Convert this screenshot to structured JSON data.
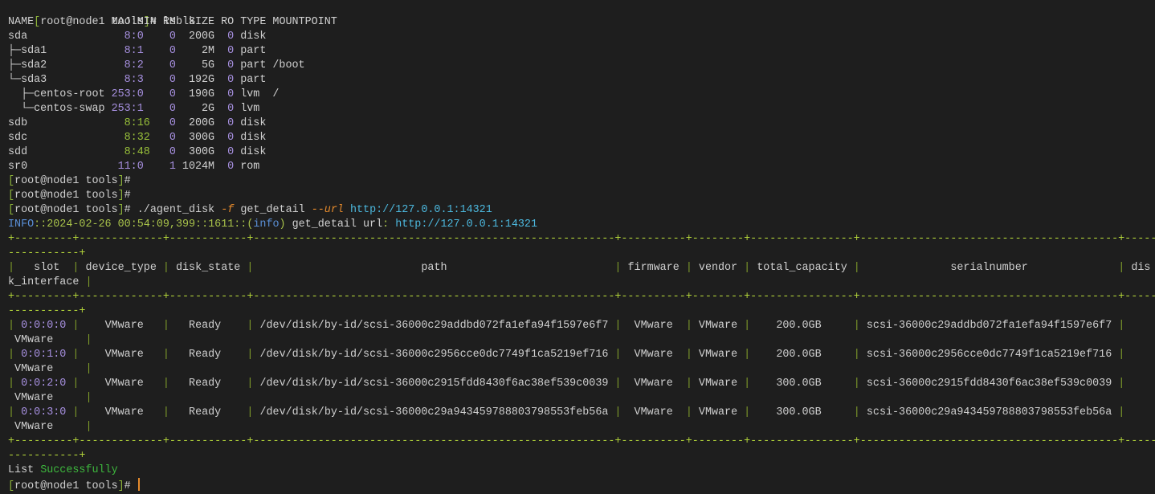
{
  "prompt": {
    "open": "[",
    "user_host": "root@node1 tools",
    "close": "]",
    "hash": "# "
  },
  "commands": {
    "lsblk": "lsblk",
    "agent": {
      "program": "./agent_disk ",
      "flag_f": "-f",
      "action": " get_detail ",
      "flag_url": "--url",
      "url": " http://127.0.0.1:14321"
    }
  },
  "lsblk": {
    "headers": {
      "name": "NAME",
      "majmin": "MAJ:MIN",
      "rm": "RM",
      "size": "SIZE",
      "ro": "RO",
      "type": "TYPE",
      "mountpoint": "MOUNTPOINT"
    },
    "rows": [
      {
        "name": "sda",
        "maj": "8",
        "min": "0",
        "rm": "0",
        "size": "200G",
        "ro": "0",
        "type": "disk",
        "mountpoint": "",
        "color": "purple"
      },
      {
        "name": "├─sda1",
        "maj": "8",
        "min": "1",
        "rm": "0",
        "size": "2M",
        "ro": "0",
        "type": "part",
        "mountpoint": "",
        "color": "purple"
      },
      {
        "name": "├─sda2",
        "maj": "8",
        "min": "2",
        "rm": "0",
        "size": "5G",
        "ro": "0",
        "type": "part",
        "mountpoint": "/boot",
        "color": "purple"
      },
      {
        "name": "└─sda3",
        "maj": "8",
        "min": "3",
        "rm": "0",
        "size": "192G",
        "ro": "0",
        "type": "part",
        "mountpoint": "",
        "color": "purple"
      },
      {
        "name": "  ├─centos-root",
        "maj": "253",
        "min": "0",
        "rm": "0",
        "size": "190G",
        "ro": "0",
        "type": "lvm",
        "mountpoint": "/",
        "color": "purple"
      },
      {
        "name": "  └─centos-swap",
        "maj": "253",
        "min": "1",
        "rm": "0",
        "size": "2G",
        "ro": "0",
        "type": "lvm",
        "mountpoint": "",
        "color": "purple"
      },
      {
        "name": "sdb",
        "maj": "8",
        "min": "16",
        "rm": "0",
        "size": "200G",
        "ro": "0",
        "type": "disk",
        "mountpoint": "",
        "color": "green"
      },
      {
        "name": "sdc",
        "maj": "8",
        "min": "32",
        "rm": "0",
        "size": "300G",
        "ro": "0",
        "type": "disk",
        "mountpoint": "",
        "color": "green"
      },
      {
        "name": "sdd",
        "maj": "8",
        "min": "48",
        "rm": "0",
        "size": "300G",
        "ro": "0",
        "type": "disk",
        "mountpoint": "",
        "color": "green"
      },
      {
        "name": "sr0",
        "maj": "11",
        "min": "0",
        "rm": "1",
        "size": "1024M",
        "ro": "0",
        "type": "rom",
        "mountpoint": "",
        "color": "purple"
      }
    ]
  },
  "info_log": {
    "level": "INFO",
    "meta": "::2024-02-26 00:54:09,399::1611::(",
    "tag": "info",
    "close": ")",
    "message": " get_detail url",
    "colon": ": ",
    "url": "http://127.0.0.1:14321"
  },
  "disk_table": {
    "columns": [
      "slot",
      "device_type",
      "disk_state",
      "path",
      "firmware",
      "vendor",
      "total_capacity",
      "serialnumber",
      "disk_interface"
    ],
    "rows": [
      [
        "0:0:0:0",
        "VMware",
        "Ready",
        "/dev/disk/by-id/scsi-36000c29addbd072fa1efa94f1597e6f7",
        "VMware",
        "VMware",
        "200.0GB",
        "scsi-36000c29addbd072fa1efa94f1597e6f7",
        "VMware"
      ],
      [
        "0:0:1:0",
        "VMware",
        "Ready",
        "/dev/disk/by-id/scsi-36000c2956cce0dc7749f1ca5219ef716",
        "VMware",
        "VMware",
        "200.0GB",
        "scsi-36000c2956cce0dc7749f1ca5219ef716",
        "VMware"
      ],
      [
        "0:0:2:0",
        "VMware",
        "Ready",
        "/dev/disk/by-id/scsi-36000c2915fdd8430f6ac38ef539c0039",
        "VMware",
        "VMware",
        "300.0GB",
        "scsi-36000c2915fdd8430f6ac38ef539c0039",
        "VMware"
      ],
      [
        "0:0:3:0",
        "VMware",
        "Ready",
        "/dev/disk/by-id/scsi-36000c29a943459788803798553feb56a",
        "VMware",
        "VMware",
        "300.0GB",
        "scsi-36000c29a943459788803798553feb56a",
        "VMware"
      ]
    ]
  },
  "result": {
    "prefix": "List ",
    "status": "Successfully"
  },
  "colors": {
    "background": "#1e1e1e",
    "table_border": "#b2d43a",
    "success": "#3db83d",
    "cursor": "#e58a2c"
  }
}
